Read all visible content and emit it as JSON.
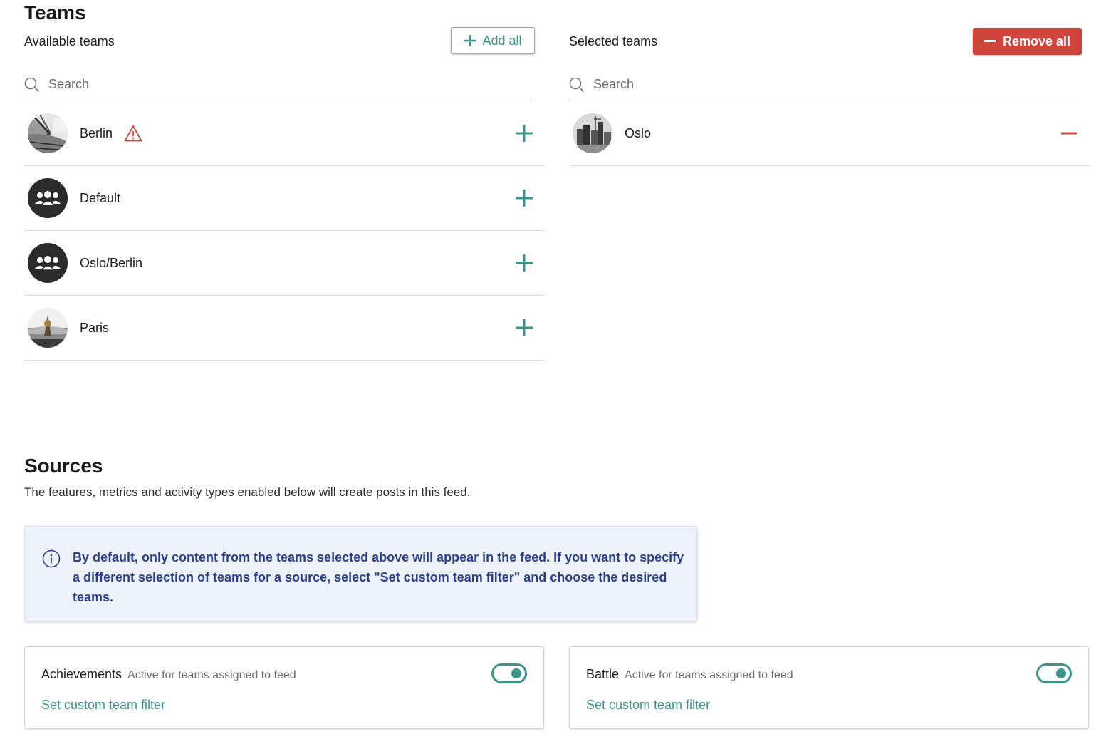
{
  "teams": {
    "heading": "Teams",
    "available": {
      "title": "Available teams",
      "add_all_label": "Add all",
      "search_placeholder": "Search",
      "items": [
        {
          "name": "Berlin",
          "warning": true
        },
        {
          "name": "Default"
        },
        {
          "name": "Oslo/Berlin"
        },
        {
          "name": "Paris"
        }
      ]
    },
    "selected": {
      "title": "Selected teams",
      "remove_all_label": "Remove all",
      "search_placeholder": "Search",
      "items": [
        {
          "name": "Oslo"
        }
      ]
    }
  },
  "sources": {
    "heading": "Sources",
    "description": "The features, metrics and activity types enabled below will create posts in this feed.",
    "info": "By default, only content from the teams selected above will appear in the feed. If you want to specify a different selection of teams for a source, select \"Set custom team filter\" and choose the desired teams.",
    "cards": [
      {
        "title": "Achievements",
        "status": "Active for teams assigned to feed",
        "link": "Set custom team filter",
        "enabled": true
      },
      {
        "title": "Battle",
        "status": "Active for teams assigned to feed",
        "link": "Set custom team filter",
        "enabled": true
      }
    ]
  },
  "colors": {
    "accent": "#3a958d",
    "danger": "#cf443b",
    "info_text": "#2b3f8c",
    "info_bg": "#eef3fb"
  }
}
